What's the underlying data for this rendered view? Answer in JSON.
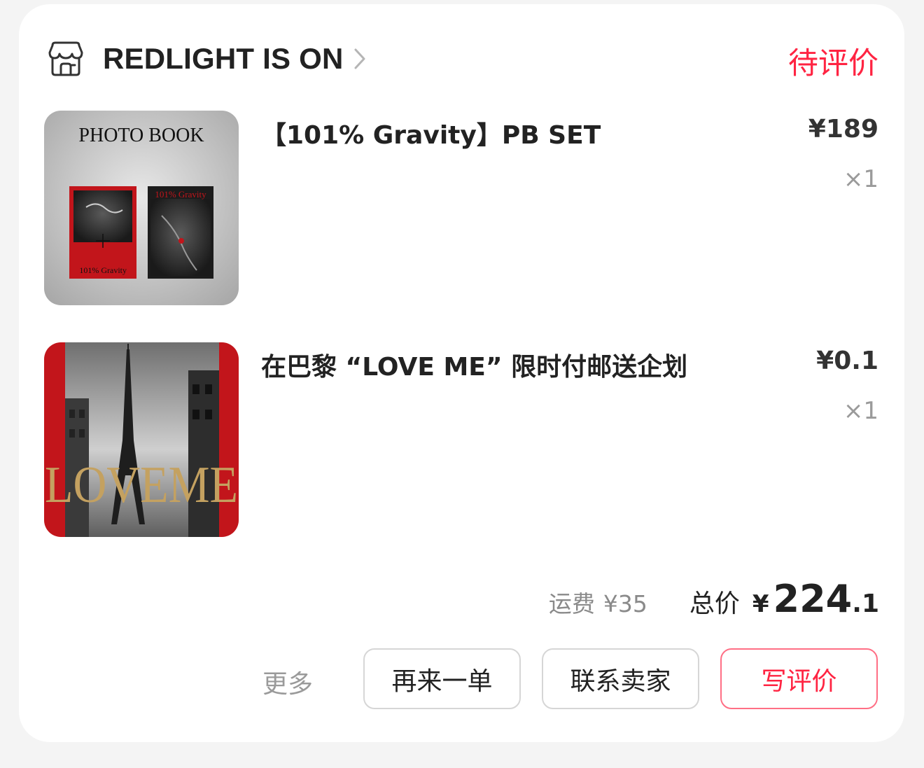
{
  "shop": {
    "name": "REDLIGHT IS ON",
    "icon": "store-icon",
    "chevron_icon": "chevron-right-icon"
  },
  "order": {
    "status": "待评价"
  },
  "items": [
    {
      "title": "【101% Gravity】PB SET",
      "price": "¥189",
      "quantity": "×1",
      "thumb": {
        "heading": "PHOTO BOOK",
        "cover_left_text": "101% Gravity",
        "cover_right_text": "101% Gravity"
      }
    },
    {
      "title": "在巴黎 “LOVE ME” 限时付邮送企划",
      "price": "¥0.1",
      "quantity": "×1",
      "thumb": {
        "overlay_text": "LOVEME"
      }
    }
  ],
  "summary": {
    "shipping_label": "运费",
    "shipping_value": "¥35",
    "total_label": "总价",
    "total_currency": "¥",
    "total_integer": "224",
    "total_decimal": ".1"
  },
  "actions": {
    "more_label": "更多",
    "reorder_label": "再来一单",
    "contact_label": "联系卖家",
    "review_label": "写评价"
  },
  "colors": {
    "accent": "#ff2442",
    "text_primary": "#222222",
    "text_secondary": "#9a9a9a",
    "thumb_red": "#c2151b"
  }
}
